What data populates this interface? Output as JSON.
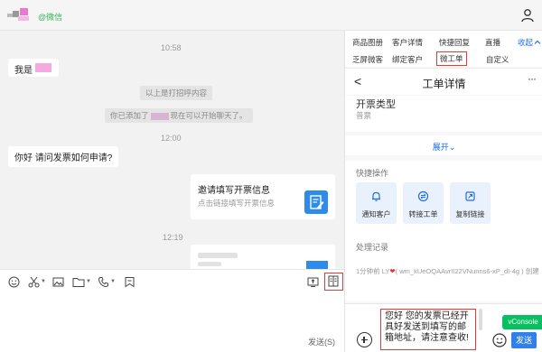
{
  "header": {
    "contact_tag": "@微信",
    "colors": {
      "accent_green": "#3bb15a",
      "blur_pink": "#e864c8"
    },
    "icons": {
      "person": "person-icon"
    }
  },
  "chat": {
    "times": [
      "10:58",
      "12:00",
      "12:19"
    ],
    "messages": {
      "greeting": "我是",
      "system_1": "以上是打招呼内容",
      "system_2_prefix": "你已添加了",
      "system_2_suffix": "现在可以开始聊天了。",
      "question": "你好 请问发票如何申请?"
    },
    "card": {
      "title": "邀请填写开票信息",
      "subtitle": "点击链接填写开票信息",
      "icon": "form-edit-icon"
    }
  },
  "toolbar": {
    "icons": [
      "emoji-icon",
      "scissors-icon",
      "image-icon",
      "folder-icon",
      "phone-icon",
      "favorite-icon",
      "screen-share-icon",
      "work-order-panel-icon"
    ],
    "send_hint": "发送(S)"
  },
  "right_panel": {
    "tabs_row1": [
      "商品图册",
      "客户详情",
      "快捷回复",
      "直播",
      "收起"
    ],
    "tabs_row2": [
      "乏屏微客",
      "绑定客户",
      "微工单",
      "自定义"
    ],
    "header": {
      "back": "<",
      "title": "工单详情",
      "more": "···"
    },
    "field": {
      "label": "开票类型",
      "value": "普票"
    },
    "expand": "展开",
    "quick_ops": {
      "title": "快捷操作",
      "items": [
        {
          "label": "通知客户",
          "icon": "bell-icon"
        },
        {
          "label": "转接工单",
          "icon": "transfer-icon"
        },
        {
          "label": "复制链接",
          "icon": "copy-link-icon"
        }
      ]
    },
    "records": {
      "title": "处理记录",
      "entry_prefix": "1分钟前 LY",
      "entry_suffix": "( wm_kUeOQAAvrII22VNunns6-xP_dI-4g ) 创建"
    },
    "composer": {
      "message": "您好 您的发票已经开具好发送到填写的邮箱地址，请注意查收!",
      "vconsole": "vConsole",
      "send": "发送"
    }
  }
}
